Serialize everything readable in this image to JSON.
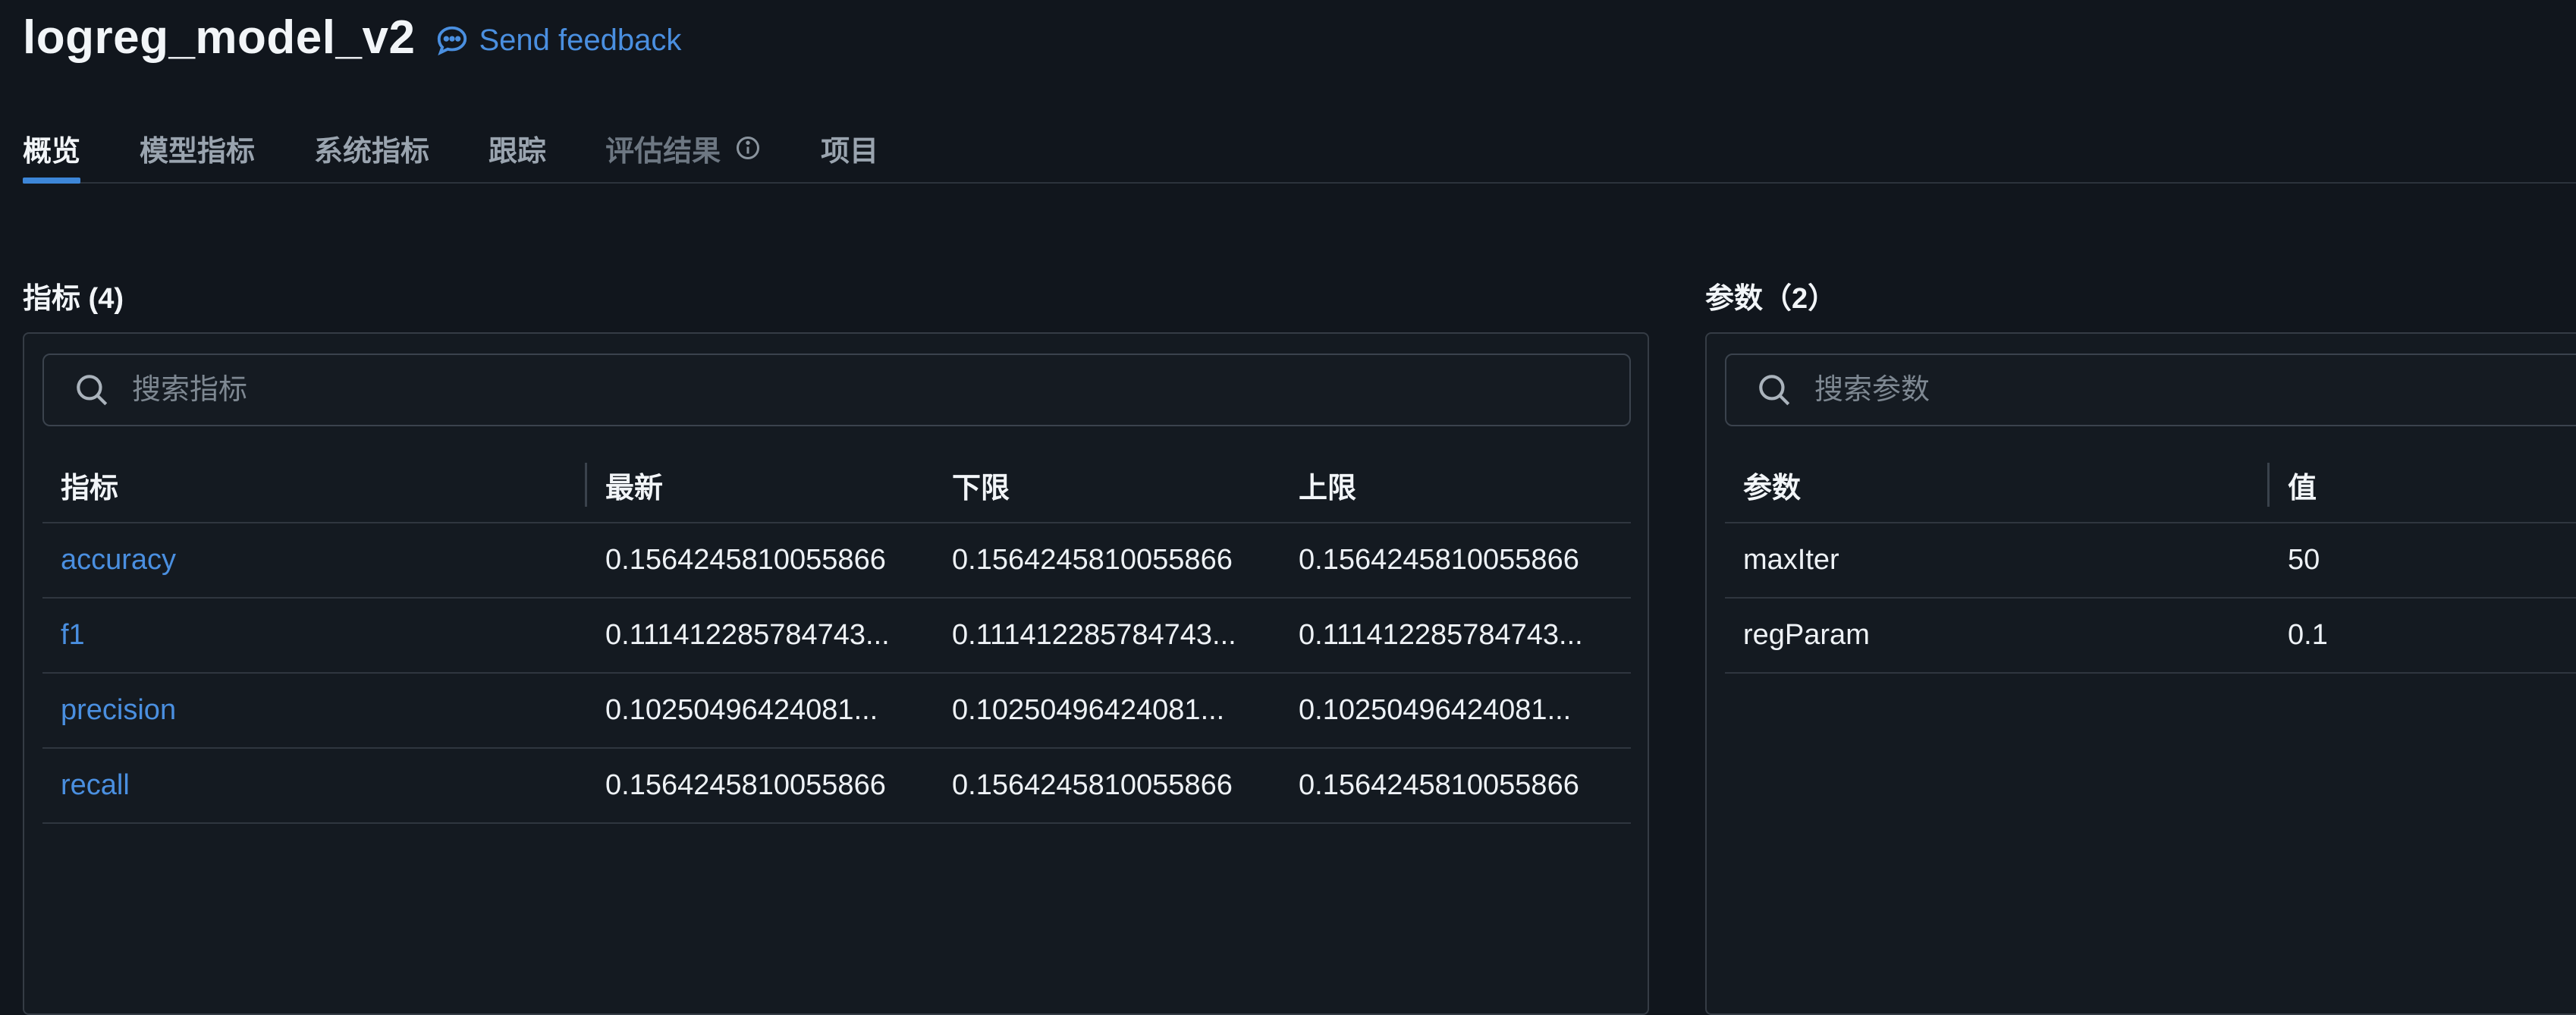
{
  "header": {
    "title": "logreg_model_v2",
    "feedback_label": "Send feedback"
  },
  "tabs": [
    {
      "label": "概览",
      "active": true
    },
    {
      "label": "模型指标"
    },
    {
      "label": "系统指标"
    },
    {
      "label": "跟踪"
    },
    {
      "label": "评估结果",
      "disabled": true
    },
    {
      "label": "项目"
    }
  ],
  "metrics": {
    "title": "指标 (4)",
    "search_placeholder": "搜索指标",
    "columns": [
      "指标",
      "最新",
      "下限",
      "上限"
    ],
    "rows": [
      {
        "name": "accuracy",
        "latest": "0.1564245810055866",
        "min": "0.1564245810055866",
        "max": "0.1564245810055866"
      },
      {
        "name": "f1",
        "latest": "0.111412285784743...",
        "min": "0.111412285784743...",
        "max": "0.111412285784743..."
      },
      {
        "name": "precision",
        "latest": "0.10250496424081...",
        "min": "0.10250496424081...",
        "max": "0.10250496424081..."
      },
      {
        "name": "recall",
        "latest": "0.1564245810055866",
        "min": "0.1564245810055866",
        "max": "0.1564245810055866"
      }
    ]
  },
  "params": {
    "title": "参数（2）",
    "search_placeholder": "搜索参数",
    "columns": [
      "参数",
      "值"
    ],
    "rows": [
      {
        "name": "maxIter",
        "value": "50"
      },
      {
        "name": "regParam",
        "value": "0.1"
      }
    ]
  },
  "colors": {
    "background": "#11161d",
    "accent": "#3d86d8",
    "link": "#4a8fe0"
  }
}
